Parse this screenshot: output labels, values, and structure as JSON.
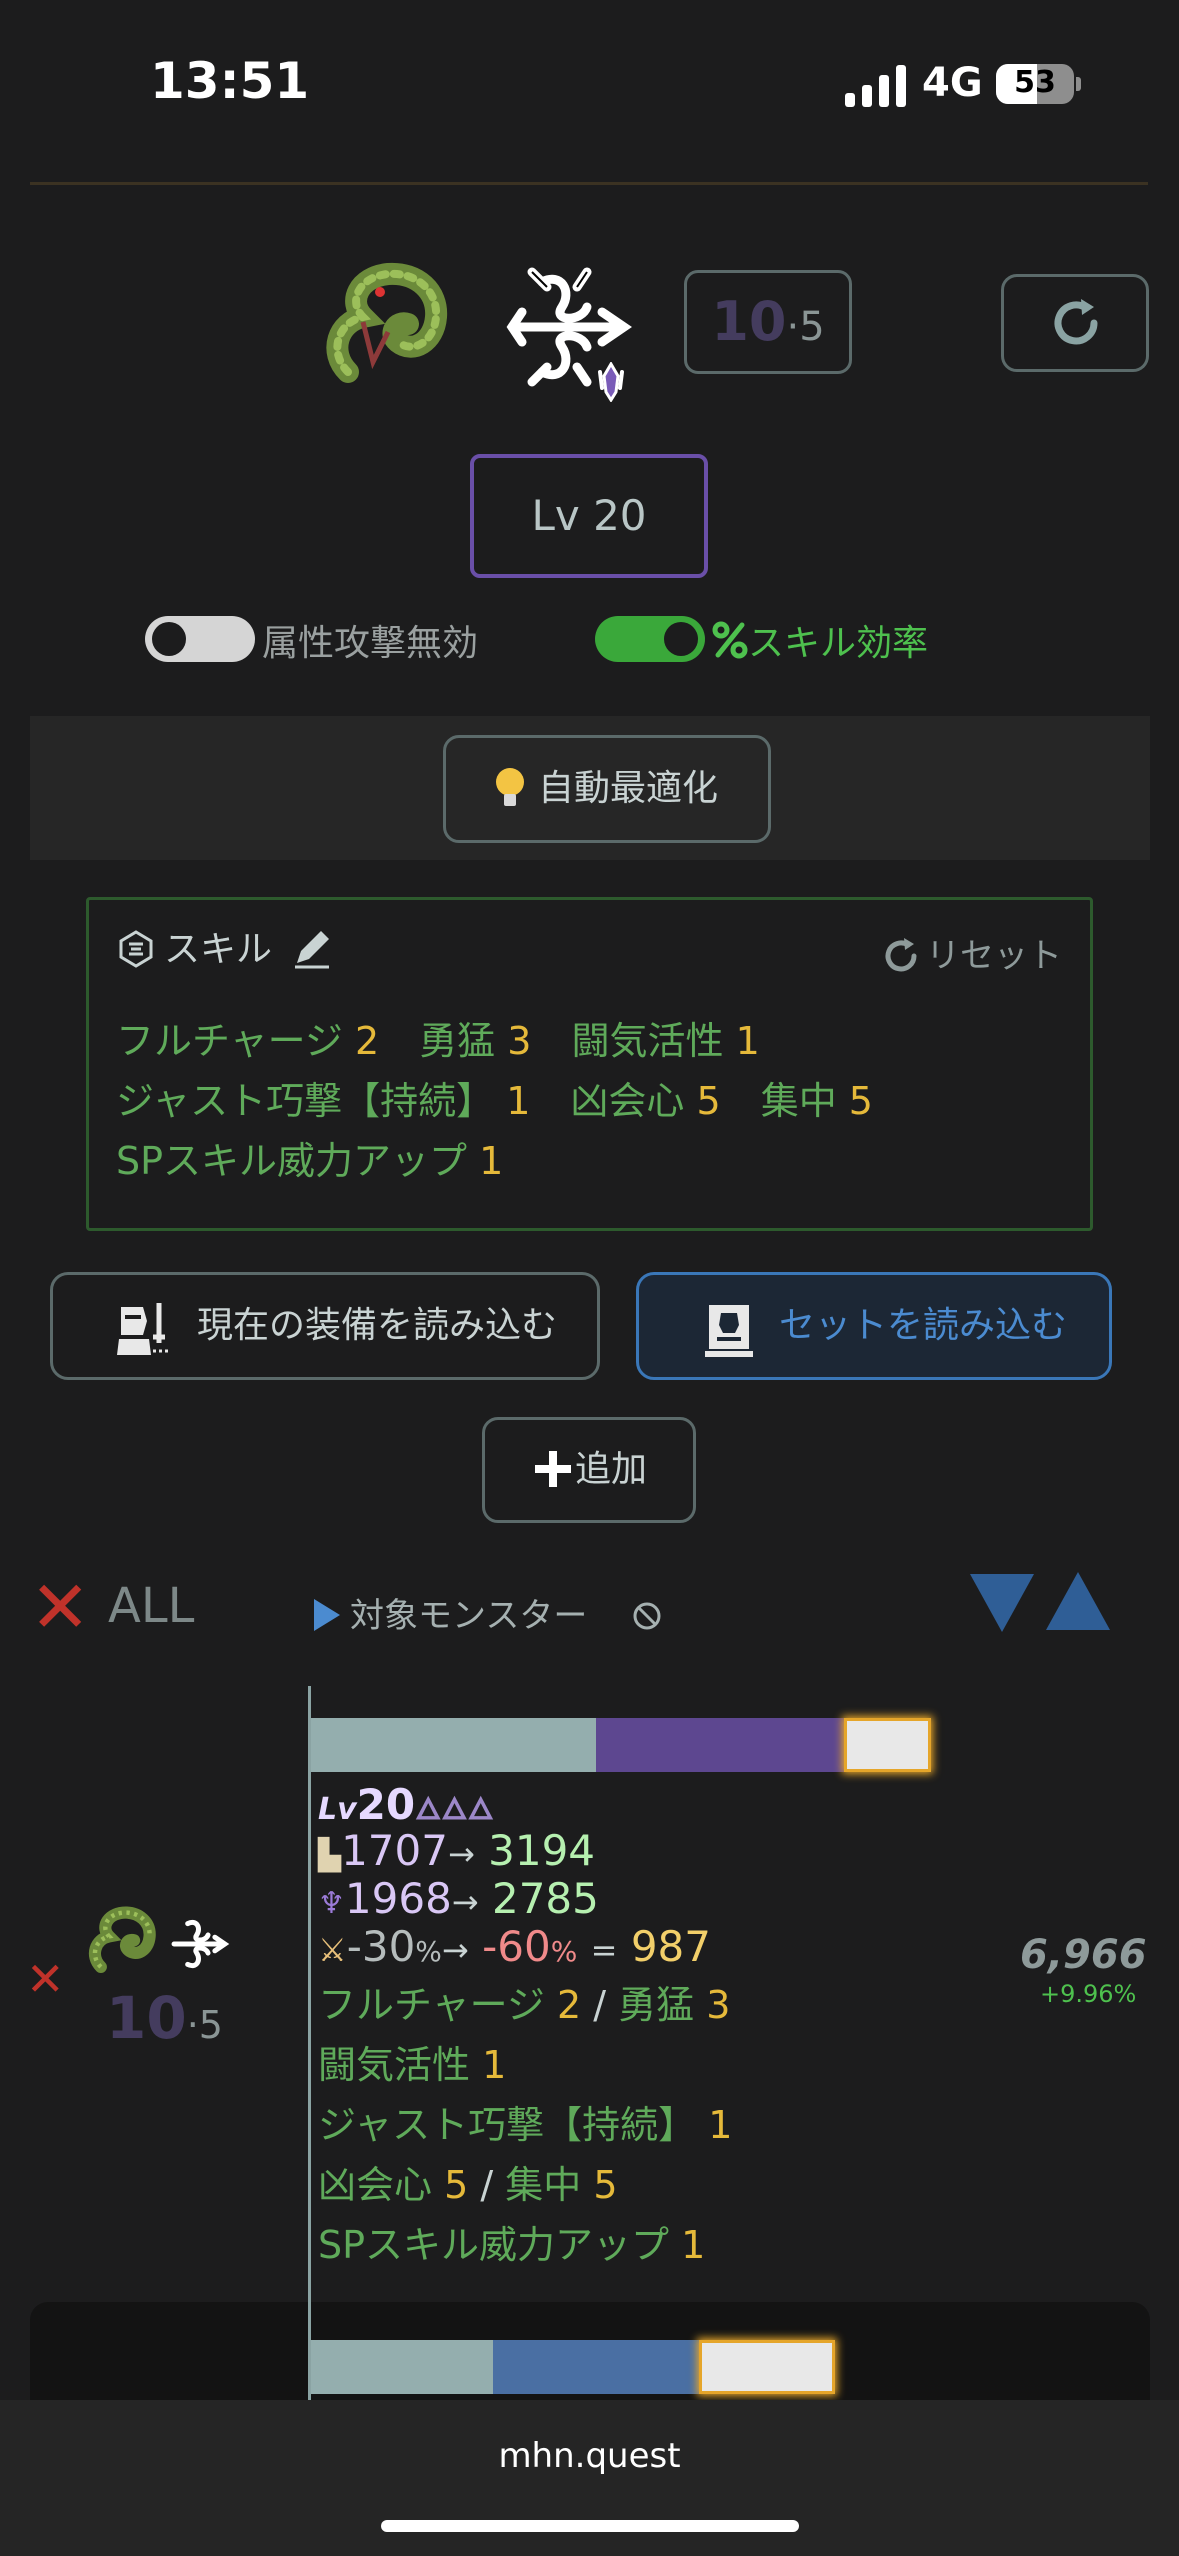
{
  "status_bar": {
    "time": "13:51",
    "network": "4G",
    "battery": "53",
    "battery_level": 0.53
  },
  "header": {
    "monster_icon": "green-coiled-monster-icon",
    "weapon_icon": "bow-weapon-icon",
    "element_icon": "dragon-element-icon",
    "rating_big": "10",
    "rating_small": "·5",
    "refresh_icon": "refresh-icon",
    "level_label": "Lv 20"
  },
  "toggles": {
    "element_disabled": {
      "label": "属性攻撃無効",
      "on": false
    },
    "skill_efficiency": {
      "icon": "percent-icon",
      "label": "スキル効率",
      "on": true
    }
  },
  "auto_optimize": {
    "icon": "lightbulb-icon",
    "label": "自動最適化"
  },
  "skill_panel": {
    "title": "スキル",
    "reset_label": "リセット",
    "lines": [
      [
        {
          "name": "フルチャージ",
          "lvl": "2"
        },
        {
          "name": "勇猛",
          "lvl": "3"
        },
        {
          "name": "闘気活性",
          "lvl": "1"
        }
      ],
      [
        {
          "name": "ジャスト巧撃【持続】",
          "lvl": "1"
        },
        {
          "name": "凶会心",
          "lvl": "5"
        },
        {
          "name": "集中",
          "lvl": "5"
        }
      ],
      [
        {
          "name": "SPスキル威力アップ",
          "lvl": "1"
        }
      ]
    ]
  },
  "load_buttons": {
    "current": "現在の装備を読み込む",
    "set": "セットを読み込む"
  },
  "add_button": "追加",
  "list_controls": {
    "clear_all": "ALL",
    "target_monster": "対象モンスター",
    "target_monster_icon": "disabled-icon"
  },
  "results": [
    {
      "rating_big": "10",
      "rating_small": "·5",
      "bar": [
        {
          "color": "#94aeae",
          "value": 0.46
        },
        {
          "color": "#5d4790",
          "value": 0.4
        },
        {
          "color": "#e8e8e8",
          "value": 0.14
        }
      ],
      "level": "20",
      "attack_from": "1707",
      "attack_to": "3194",
      "element_from": "1968",
      "element_to": "2785",
      "affinity_from": "-30",
      "affinity_to": "-60",
      "pct_unit": "%",
      "arrow": "→",
      "equals": "=",
      "affinity_result": "987",
      "skill_lines": [
        [
          {
            "name": "フルチャージ",
            "lvl": "2"
          },
          {
            "name": "勇猛",
            "lvl": "3"
          }
        ],
        [
          {
            "name": "闘気活性",
            "lvl": "1"
          }
        ],
        [
          {
            "name": "ジャスト巧撃【持続】",
            "lvl": "1"
          }
        ],
        [
          {
            "name": "凶会心",
            "lvl": "5"
          },
          {
            "name": "集中",
            "lvl": "5"
          }
        ],
        [
          {
            "name": "SPスキル威力アップ",
            "lvl": "1"
          }
        ]
      ],
      "separator": "/",
      "score": "6,966",
      "score_diff": "+9.96%"
    },
    {
      "bar": [
        {
          "color": "#94aeae",
          "value": 0.32
        },
        {
          "color": "#4a6fa3",
          "value": 0.36
        },
        {
          "color": "#e8e8e8",
          "value": 0.24
        }
      ]
    }
  ],
  "browser": {
    "url": "mhn.quest"
  }
}
